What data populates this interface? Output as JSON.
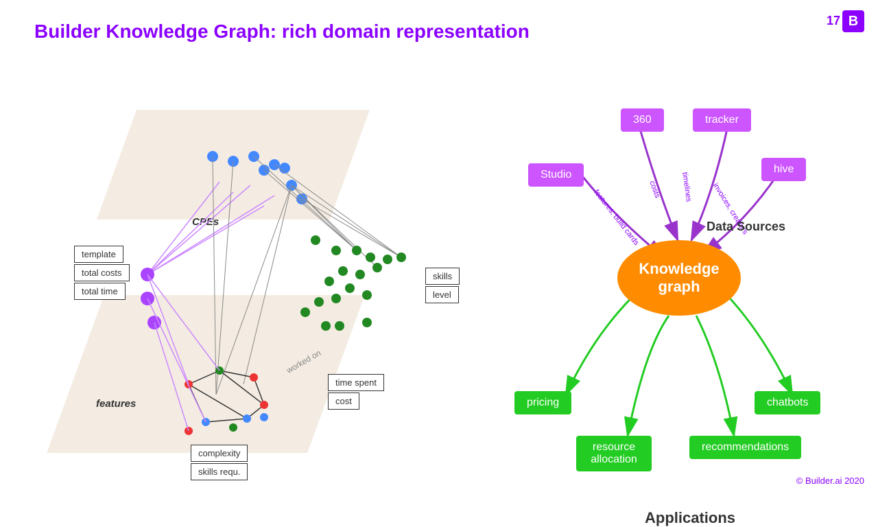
{
  "header": {
    "title": "Builder Knowledge Graph: rich domain representation",
    "slide_number": "17",
    "logo": "B"
  },
  "left": {
    "cpes_label": "CPEs",
    "features_label": "features",
    "worked_on_label": "worked on",
    "legend_boxes": {
      "template": "template",
      "total_costs": "total costs",
      "total_time": "total time",
      "skills": "skills",
      "level": "level",
      "time_spent": "time spent",
      "cost": "cost",
      "complexity": "complexity",
      "skills_requ": "skills requ."
    }
  },
  "right": {
    "center": {
      "line1": "Knowledge",
      "line2": "graph"
    },
    "data_sources_label": "Data Sources",
    "applications_label": "Applications",
    "purple_boxes": {
      "360": "360",
      "tracker": "tracker",
      "studio": "Studio",
      "hive": "hive"
    },
    "green_boxes": {
      "pricing": "pricing",
      "chatbots": "chatbots",
      "resource_allocation": "resource\nallocation",
      "recommendations": "recommendations"
    },
    "edge_labels": {
      "costs": "costs",
      "features_build_cards": "features,\nbuild cards",
      "timelines": "timelines",
      "invoices_creators": "invoices,\ncreators"
    }
  },
  "copyright": "© Builder.ai 2020"
}
